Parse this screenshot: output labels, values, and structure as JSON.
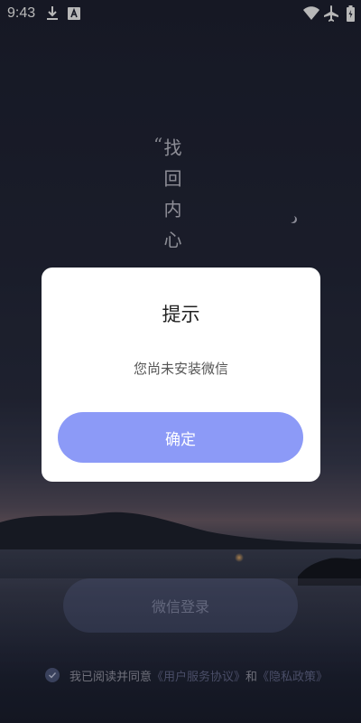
{
  "status_bar": {
    "time": "9:43",
    "icons": [
      "download-icon",
      "font-a-icon",
      "wifi-icon",
      "airplane-icon",
      "battery-icon"
    ]
  },
  "background": {
    "quote_mark": "“",
    "slogan": "找回内心"
  },
  "login": {
    "wechat_login_label": "微信登录"
  },
  "agreement": {
    "prefix": "我已阅读并同意",
    "user_agreement": "《用户服务协议》",
    "conjunction": "和",
    "privacy_policy": "《隐私政策》"
  },
  "dialog": {
    "title": "提示",
    "message": "您尚未安装微信",
    "confirm_label": "确定"
  },
  "colors": {
    "accent": "#8c9af7",
    "dialog_bg": "#ffffff"
  }
}
